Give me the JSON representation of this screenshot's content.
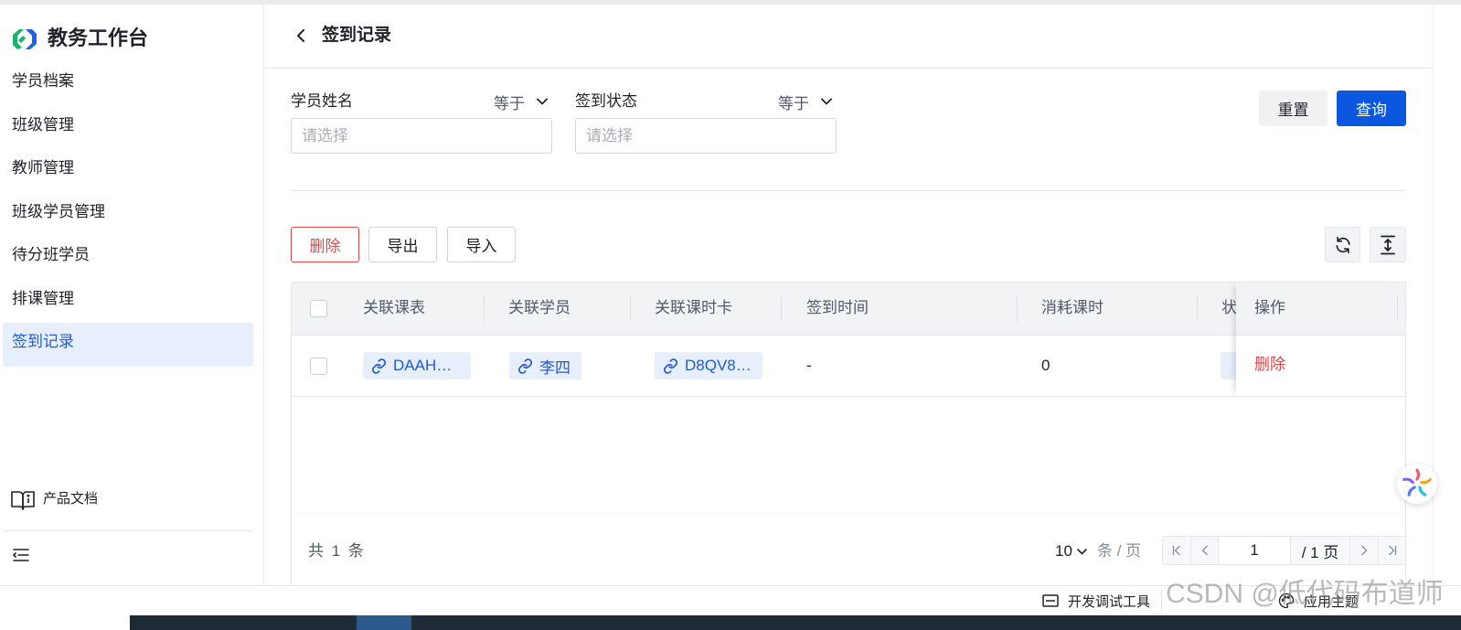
{
  "app": {
    "title": "教务工作台",
    "logo_icon": "brand-logo-icon"
  },
  "sidebar": {
    "items": [
      {
        "label": "学员档案",
        "active": false
      },
      {
        "label": "班级管理",
        "active": false
      },
      {
        "label": "教师管理",
        "active": false
      },
      {
        "label": "班级学员管理",
        "active": false
      },
      {
        "label": "待分班学员",
        "active": false
      },
      {
        "label": "排课管理",
        "active": false
      },
      {
        "label": "签到记录",
        "active": true
      }
    ],
    "docs_label": "产品文档",
    "docs_icon": "book-icon",
    "collapse_icon": "menu-collapse-icon"
  },
  "header": {
    "title": "签到记录",
    "back_icon": "chevron-left-icon"
  },
  "filters": [
    {
      "label": "学员姓名",
      "operator": "等于",
      "placeholder": "请选择",
      "value": ""
    },
    {
      "label": "签到状态",
      "operator": "等于",
      "placeholder": "请选择",
      "value": ""
    }
  ],
  "filter_actions": {
    "reset_label": "重置",
    "query_label": "查询"
  },
  "toolbar": {
    "delete_label": "删除",
    "export_label": "导出",
    "import_label": "导入",
    "refresh_icon": "refresh-icon",
    "row_height_icon": "column-height-icon"
  },
  "table": {
    "columns": [
      "关联课表",
      "关联学员",
      "关联课时卡",
      "签到时间",
      "消耗课时",
      "状",
      "操作"
    ],
    "rows": [
      {
        "course": "DAAH…",
        "student": "李四",
        "card": "D8QV8…",
        "sign_time": "-",
        "consumed_hours": "0",
        "action": "删除"
      }
    ]
  },
  "pagination": {
    "total": "共 1 条",
    "page_size": "10",
    "page_size_unit": "条 / 页",
    "current_page": "1",
    "total_pages": "/ 1 页"
  },
  "footer": {
    "devtools_label": "开发调试工具",
    "theme_label": "应用主题"
  },
  "watermark": "CSDN @低代码布道师",
  "colors": {
    "accent": "#0b57e0",
    "danger": "#e04848",
    "tag_bg": "#e7eefc",
    "tag_text": "#1f5bd6",
    "active_bg": "#e8effc",
    "active_text": "#1f5bd6"
  }
}
